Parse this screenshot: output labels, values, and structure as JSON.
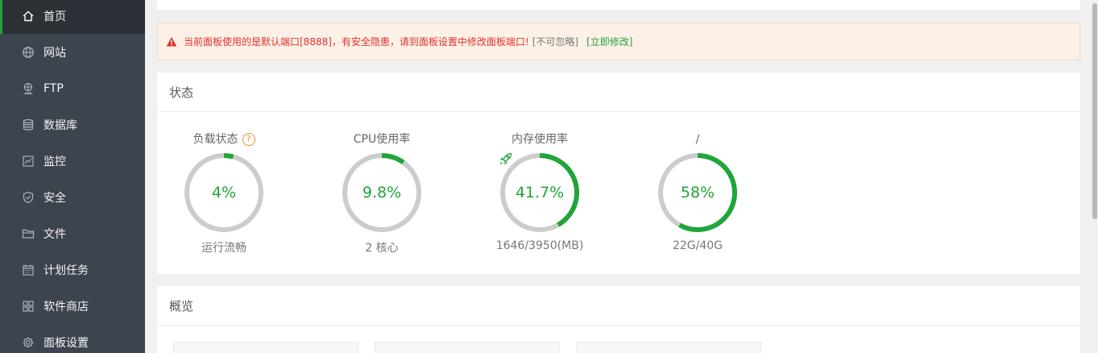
{
  "sidebar": {
    "items": [
      {
        "label": "首页",
        "icon": "home-icon",
        "active": true
      },
      {
        "label": "网站",
        "icon": "globe-icon"
      },
      {
        "label": "FTP",
        "icon": "ftp-icon"
      },
      {
        "label": "数据库",
        "icon": "database-icon"
      },
      {
        "label": "监控",
        "icon": "monitor-icon"
      },
      {
        "label": "安全",
        "icon": "shield-icon"
      },
      {
        "label": "文件",
        "icon": "folder-icon"
      },
      {
        "label": "计划任务",
        "icon": "calendar-icon"
      },
      {
        "label": "软件商店",
        "icon": "apps-grid-icon"
      },
      {
        "label": "面板设置",
        "icon": "gear-icon"
      }
    ]
  },
  "warning": {
    "message": "当前面板使用的是默认端口[8888]，有安全隐患，请到面板设置中修改面板端口!",
    "ignore_label": "[不可忽略]",
    "fix_label": "[立即修改]"
  },
  "status": {
    "title": "状态",
    "gauges": [
      {
        "label": "负载状态",
        "help": "?",
        "percent": 4,
        "value_text": "4%",
        "sub": "运行流畅"
      },
      {
        "label": "CPU使用率",
        "percent": 9.8,
        "value_text": "9.8%",
        "sub": "2 核心"
      },
      {
        "label": "内存使用率",
        "percent": 41.7,
        "value_text": "41.7%",
        "sub": "1646/3950(MB)",
        "icon": "rocket-icon"
      },
      {
        "label": "/",
        "percent": 58,
        "value_text": "58%",
        "sub": "22G/40G"
      }
    ]
  },
  "overview": {
    "title": "概览"
  },
  "colors": {
    "accent": "#20a53a",
    "sidebar_bg": "#3c444d",
    "warning_text": "#e0332d",
    "ring_track": "#cccccc"
  }
}
